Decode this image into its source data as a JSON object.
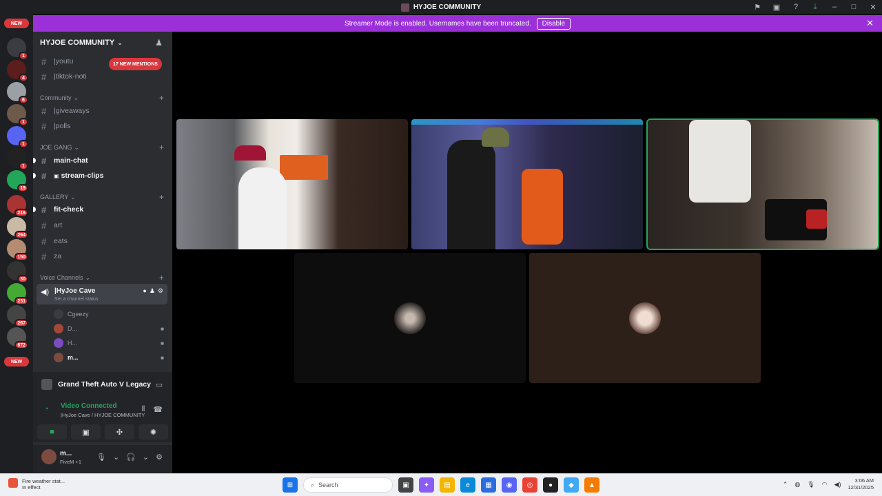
{
  "titlebar": {
    "title": "HYJOE COMMUNITY"
  },
  "banner": {
    "text": "Streamer Mode is enabled. Usernames have been truncated.",
    "button": "Disable"
  },
  "rail": {
    "new_top": "NEW",
    "new_bottom": "NEW",
    "badges": [
      "1",
      "4",
      "6",
      "1",
      "1",
      "1",
      "19",
      "216",
      "264",
      "150",
      "30",
      "231",
      "267",
      "672"
    ]
  },
  "sidebar": {
    "guild_name": "HYJOE COMMUNITY",
    "mentions_pill": "17 NEW MENTIONS",
    "channels_top": [
      {
        "name": "|youtu"
      },
      {
        "name": "|tiktok-noti"
      }
    ],
    "cat_community": "Community",
    "community_channels": [
      {
        "name": "|giveaways"
      },
      {
        "name": "|polls"
      }
    ],
    "cat_joegang": "JOE GANG",
    "joegang_channels": [
      {
        "name": "main-chat"
      },
      {
        "name": "stream-clips"
      }
    ],
    "cat_gallery": "GALLERY",
    "gallery_channels": [
      {
        "name": "fit-check"
      },
      {
        "name": "art"
      },
      {
        "name": "eats"
      },
      {
        "name": "za"
      }
    ],
    "cat_voice": "Voice Channels",
    "voice_channel": {
      "name": "|HyJoe Cave",
      "status": "Set a channel status"
    },
    "voice_users": [
      {
        "name": "Cgeezy",
        "color": "#3a3c42"
      },
      {
        "name": "D...",
        "color": "#a1483b"
      },
      {
        "name": "H...",
        "color": "#7b4cc2"
      },
      {
        "name": "m...",
        "color": "#7d4b3f"
      }
    ]
  },
  "activity": {
    "game": "Grand Theft Auto V Legacy"
  },
  "voice_panel": {
    "status": "Video Connected",
    "location": "|HyJoe Cave / HYJOE COMMUNITY"
  },
  "user_panel": {
    "name": "m...",
    "status": "FiveM +1"
  },
  "taskbar": {
    "weather_line1": "Fire weather stat...",
    "weather_line2": "In effect",
    "search_placeholder": "Search",
    "time": "3:06 AM",
    "date": "12/31/2025"
  },
  "icons": {
    "titlebar": [
      "inbox-icon",
      "monitor-icon",
      "help-icon",
      "download-icon",
      "minimize-icon",
      "maximize-icon",
      "close-icon"
    ]
  }
}
